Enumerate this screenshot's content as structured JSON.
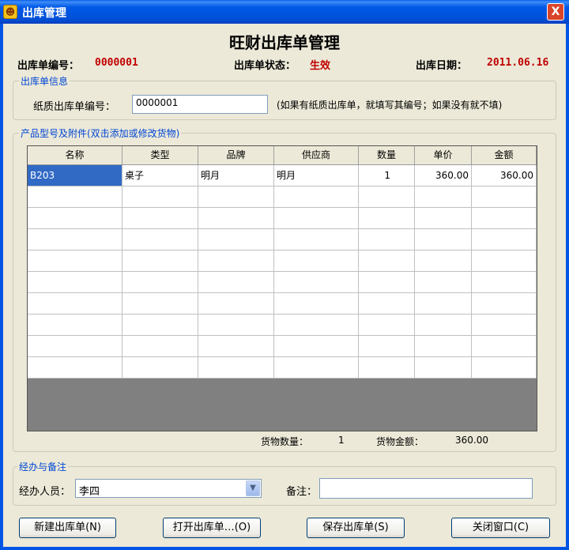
{
  "window": {
    "title": "出库管理",
    "close_glyph": "X"
  },
  "header": {
    "title": "旺财出库单管理",
    "order_no_label": "出库单编号：",
    "order_no_value": "0000001",
    "status_label": "出库单状态：",
    "status_value": "生效",
    "date_label": "出库日期：",
    "date_value": "2011.06.16"
  },
  "info_group": {
    "legend": "出库单信息",
    "paper_no_label": "纸质出库单编号：",
    "paper_no_value": "0000001",
    "hint": "(如果有纸质出库单，就填写其编号；如果没有就不填)"
  },
  "products_group": {
    "legend": "产品型号及附件(双击添加或修改货物)",
    "columns": [
      "名称",
      "类型",
      "品牌",
      "供应商",
      "数量",
      "单价",
      "金额"
    ],
    "rows": [
      [
        "B203",
        "桌子",
        "明月",
        "明月",
        "1",
        "360.00",
        "360.00"
      ]
    ],
    "count_label": "货物数量：",
    "count_value": "1",
    "amount_label": "货物金额：",
    "amount_value": "360.00"
  },
  "handler_group": {
    "legend": "经办与备注",
    "handler_label": "经办人员：",
    "handler_value": "李四",
    "remark_label": "备注：",
    "remark_value": ""
  },
  "buttons": {
    "new": "新建出库单(N)",
    "open": "打开出库单…(O)",
    "save": "保存出库单(S)",
    "close": "关闭窗口(C)"
  },
  "colors": {
    "titlebar": "#0054E3",
    "status": "#C00000",
    "legend": "#0046D5",
    "selection": "#316AC5"
  }
}
